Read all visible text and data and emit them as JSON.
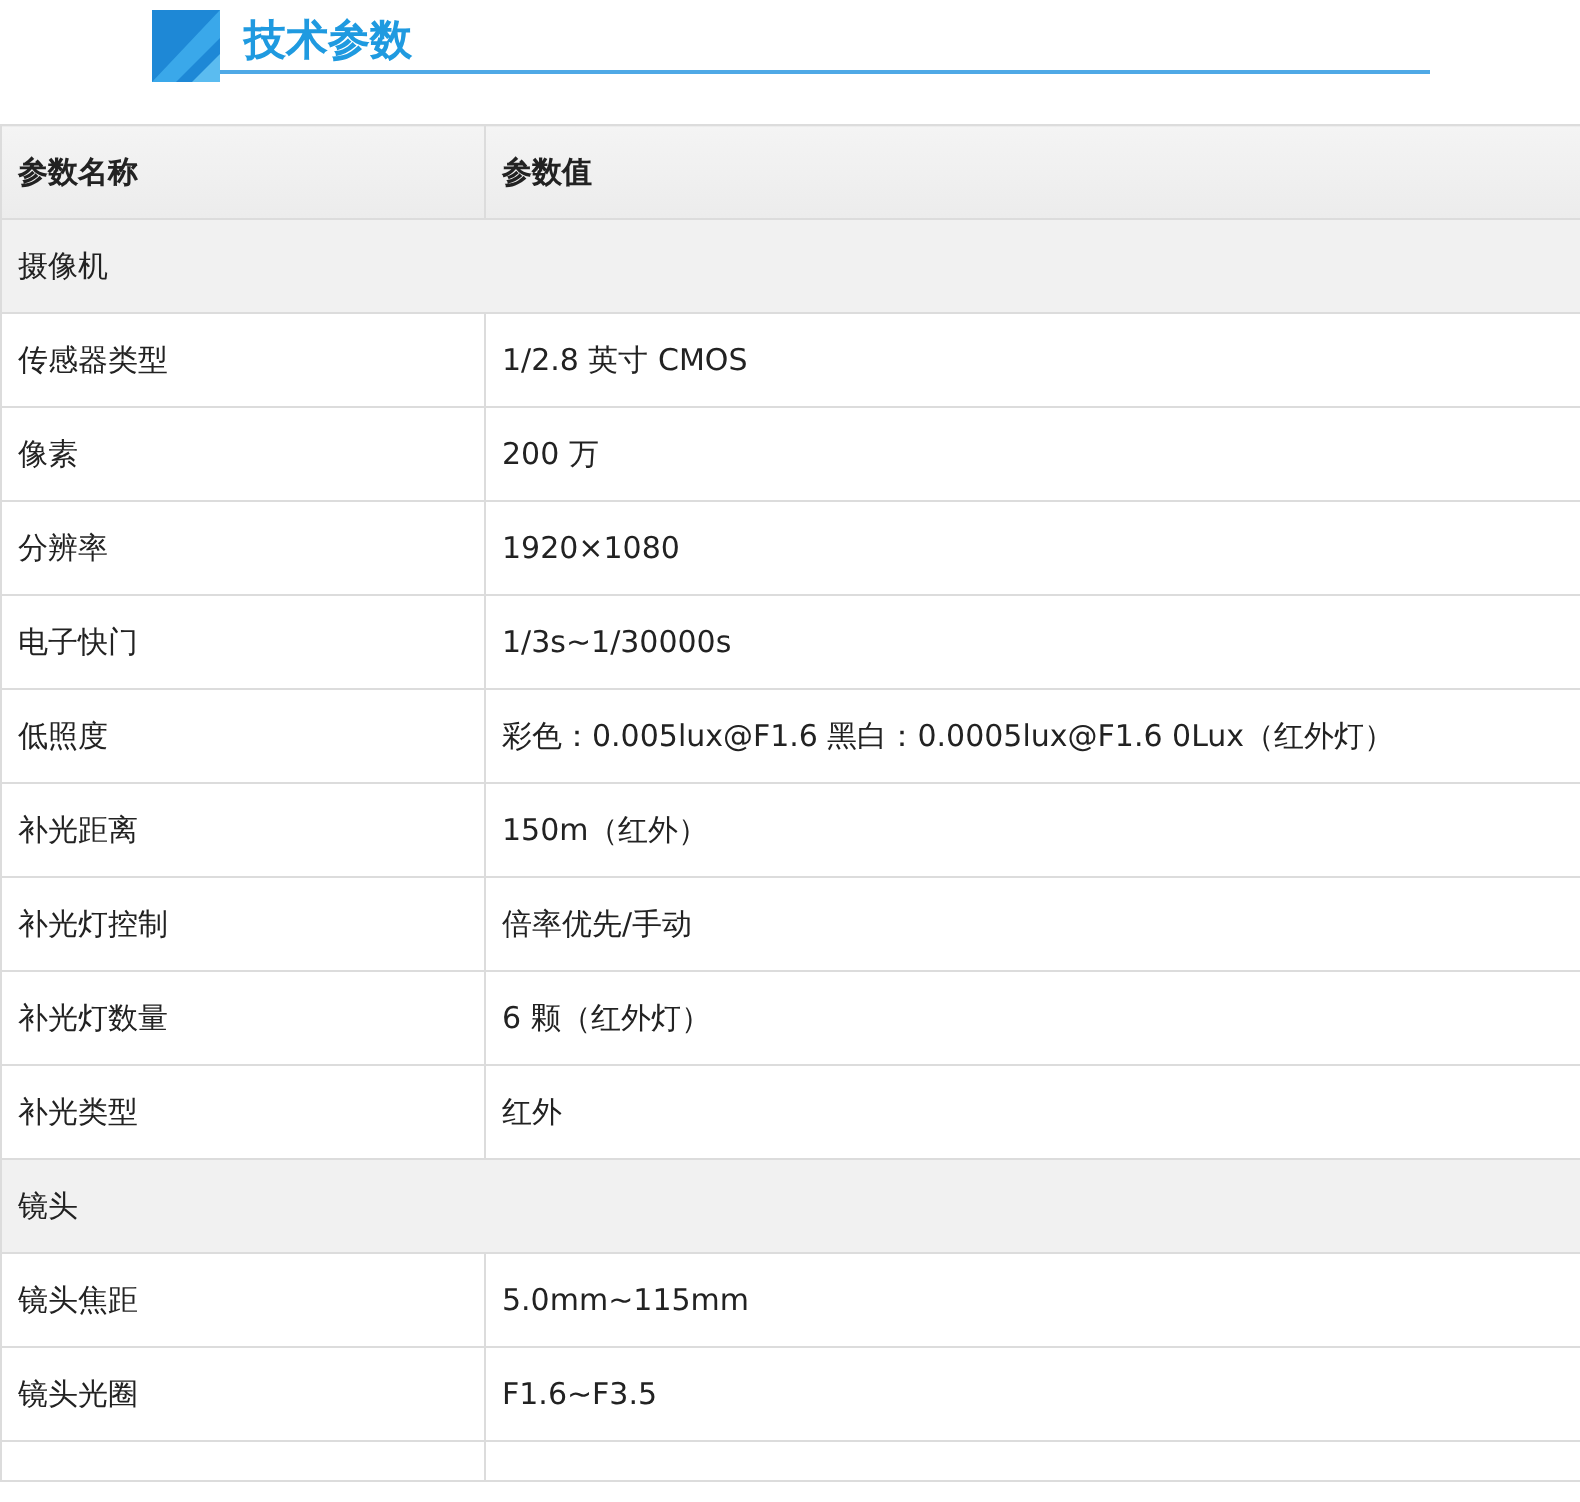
{
  "title": "技术参数",
  "table": {
    "columns": [
      "参数名称",
      "参数值"
    ],
    "rows": [
      {
        "kind": "section",
        "label": "摄像机"
      },
      {
        "kind": "param",
        "name": "传感器类型",
        "value": "1/2.8 英寸  CMOS"
      },
      {
        "kind": "param",
        "name": "像素",
        "value": "200 万"
      },
      {
        "kind": "param",
        "name": "分辨率",
        "value": "1920×1080"
      },
      {
        "kind": "param",
        "name": "电子快门",
        "value": "1/3s~1/30000s"
      },
      {
        "kind": "param",
        "name": "低照度",
        "value": "彩色：0.005lux@F1.6 黑白：0.0005lux@F1.6 0Lux（红外灯）"
      },
      {
        "kind": "param",
        "name": "补光距离",
        "value": "150m（红外）"
      },
      {
        "kind": "param",
        "name": "补光灯控制",
        "value": "倍率优先/手动"
      },
      {
        "kind": "param",
        "name": "补光灯数量",
        "value": "6 颗（红外灯）"
      },
      {
        "kind": "param",
        "name": "补光类型",
        "value": "红外"
      },
      {
        "kind": "section",
        "label": "镜头"
      },
      {
        "kind": "param",
        "name": "镜头焦距",
        "value": "5.0mm~115mm"
      },
      {
        "kind": "param",
        "name": "镜头光圈",
        "value": "F1.6~F3.5"
      }
    ]
  }
}
